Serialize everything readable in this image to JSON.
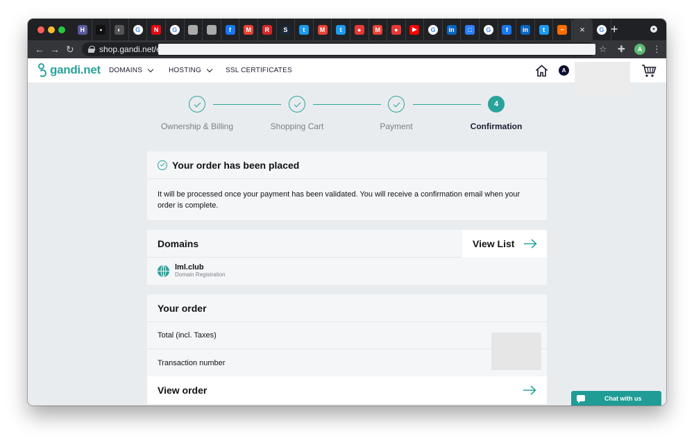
{
  "browser": {
    "tab_favicons": [
      {
        "icon": "hostinger-icon",
        "color": "#5a5a9a",
        "glyph": "H"
      },
      {
        "icon": "dark-circle-icon",
        "color": "#111111",
        "glyph": "•"
      },
      {
        "icon": "globe-grey-icon",
        "color": "#555555",
        "glyph": "◐"
      },
      {
        "icon": "google-icon",
        "color": "#ffffff",
        "glyph": "G"
      },
      {
        "icon": "netflix-icon",
        "color": "#e50914",
        "glyph": "N"
      },
      {
        "icon": "google-icon",
        "color": "#ffffff",
        "glyph": "G"
      },
      {
        "icon": "apple-icon",
        "color": "#aaaaaa",
        "glyph": ""
      },
      {
        "icon": "apple-icon",
        "color": "#aaaaaa",
        "glyph": ""
      },
      {
        "icon": "facebook-icon",
        "color": "#1877f2",
        "glyph": "f"
      },
      {
        "icon": "gmail-icon",
        "color": "#ea4335",
        "glyph": "M"
      },
      {
        "icon": "red-r-icon",
        "color": "#d62828",
        "glyph": "R"
      },
      {
        "icon": "steam-icon",
        "color": "#1b2838",
        "glyph": "S"
      },
      {
        "icon": "twitter-icon",
        "color": "#1d9bf0",
        "glyph": "t"
      },
      {
        "icon": "gmail-icon",
        "color": "#ea4335",
        "glyph": "M"
      },
      {
        "icon": "twitter-icon",
        "color": "#1d9bf0",
        "glyph": "t"
      },
      {
        "icon": "red-pin-icon",
        "color": "#e53935",
        "glyph": "●"
      },
      {
        "icon": "gmail-icon",
        "color": "#ea4335",
        "glyph": "M"
      },
      {
        "icon": "red-pin-icon",
        "color": "#e53935",
        "glyph": "●"
      },
      {
        "icon": "youtube-icon",
        "color": "#ff0000",
        "glyph": "▶"
      },
      {
        "icon": "google-icon",
        "color": "#ffffff",
        "glyph": "G"
      },
      {
        "icon": "linkedin-icon",
        "color": "#0a66c2",
        "glyph": "in"
      },
      {
        "icon": "square-icon",
        "color": "#2a7fff",
        "glyph": "□"
      },
      {
        "icon": "google-icon",
        "color": "#ffffff",
        "glyph": "G"
      },
      {
        "icon": "facebook-icon",
        "color": "#1877f2",
        "glyph": "f"
      },
      {
        "icon": "linkedin-icon",
        "color": "#0a66c2",
        "glyph": "in"
      },
      {
        "icon": "twitter-icon",
        "color": "#1d9bf0",
        "glyph": "t"
      },
      {
        "icon": "chart-icon",
        "color": "#ff6d00",
        "glyph": "~"
      },
      {
        "icon": "google-icon",
        "color": "#ffffff",
        "glyph": "G"
      }
    ],
    "active_tab_close": "×",
    "new_tab": "+",
    "url": "shop.gandi.net/en/",
    "profile_initial": "A"
  },
  "site": {
    "logo_text": "gandi.net",
    "nav": {
      "domains": "DOMAINS",
      "hosting": "HOSTING",
      "ssl": "SSL CERTIFICATES"
    },
    "account_initial": "A"
  },
  "stepper": {
    "steps": [
      {
        "label": "Ownership & Billing",
        "state": "done"
      },
      {
        "label": "Shopping Cart",
        "state": "done"
      },
      {
        "label": "Payment",
        "state": "done"
      },
      {
        "label": "Confirmation",
        "state": "current",
        "number": "4"
      }
    ]
  },
  "confirmation": {
    "title": "Your order has been placed",
    "message": "It will be processed once your payment has been validated. You will receive a confirmation email when your order is complete."
  },
  "domains_card": {
    "title": "Domains",
    "view_list": "View List",
    "items": [
      {
        "name": "lml.club",
        "type": "Domain Registration"
      }
    ]
  },
  "order_card": {
    "title": "Your order",
    "total_label": "Total (incl. Taxes)",
    "transaction_label": "Transaction number",
    "view_order": "View order"
  },
  "chat": {
    "label": "Chat with us"
  },
  "colors": {
    "accent": "#2aa39a",
    "dark": "#0d1030",
    "page_bg": "#e9ecef"
  }
}
